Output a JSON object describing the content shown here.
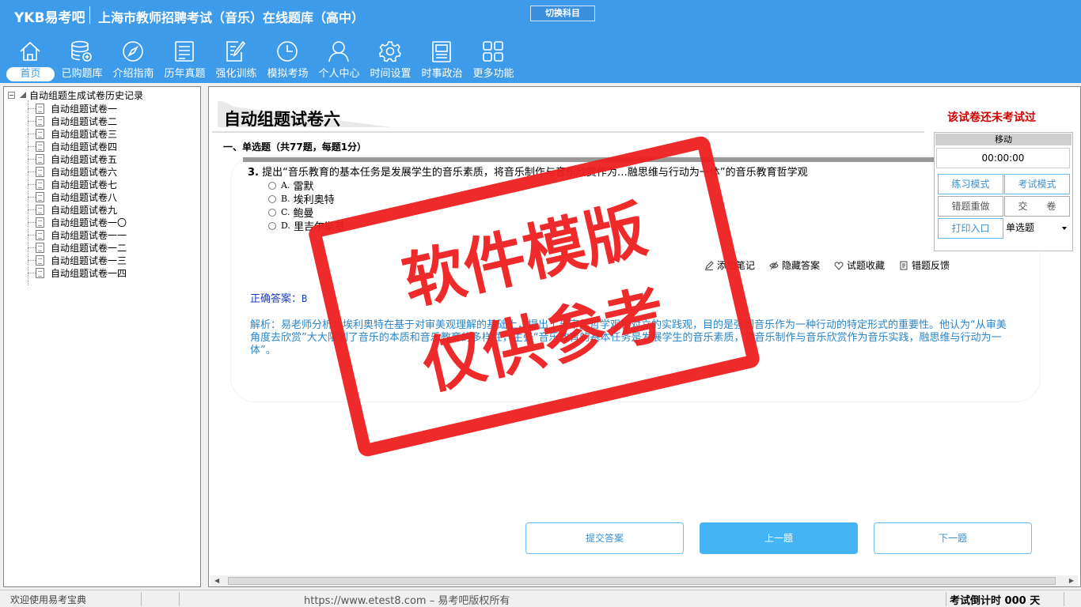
{
  "app": {
    "brand": "YKB易考吧",
    "title": "上海市教师招聘考试（音乐）在线题库（高中）",
    "switch_subject": "切换科目"
  },
  "nav": [
    {
      "label": "首页",
      "icon": "home-icon"
    },
    {
      "label": "已购题库",
      "icon": "database-icon"
    },
    {
      "label": "介绍指南",
      "icon": "compass-icon"
    },
    {
      "label": "历年真题",
      "icon": "list-icon"
    },
    {
      "label": "强化训练",
      "icon": "edit-icon"
    },
    {
      "label": "模拟考场",
      "icon": "clock-icon"
    },
    {
      "label": "个人中心",
      "icon": "user-icon"
    },
    {
      "label": "时间设置",
      "icon": "gear-icon"
    },
    {
      "label": "时事政治",
      "icon": "book-icon"
    },
    {
      "label": "更多功能",
      "icon": "grid-icon"
    }
  ],
  "tree": {
    "toggle": "−",
    "root": "自动组题生成试卷历史记录",
    "items": [
      "自动组题试卷一",
      "自动组题试卷二",
      "自动组题试卷三",
      "自动组题试卷四",
      "自动组题试卷五",
      "自动组题试卷六",
      "自动组题试卷七",
      "自动组题试卷八",
      "自动组题试卷九",
      "自动组题试卷一〇",
      "自动组题试卷一一",
      "自动组题试卷一二",
      "自动组题试卷一三",
      "自动组题试卷一四"
    ]
  },
  "paper": {
    "title": "自动组题试卷六",
    "status": "该试卷还未考试过",
    "section": "一、单选题（共77题，每题1分）"
  },
  "question": {
    "number": "3.",
    "text": "提出“音乐教育的基本任务是发展学生的音乐素质，将音乐制作与音乐欣赏作为…融思维与行动为一体”的音乐教育哲学观",
    "options": [
      {
        "key": "A.",
        "text": "雷默"
      },
      {
        "key": "B.",
        "text": "埃利奥特"
      },
      {
        "key": "C.",
        "text": "鲍曼"
      },
      {
        "key": "D.",
        "text": "里吉尔斯基"
      }
    ]
  },
  "tools": {
    "add_note": "添加笔记",
    "hide_answer": "隐藏答案",
    "favorite": "试题收藏",
    "feedback": "错题反馈"
  },
  "answer": {
    "label": "正确答案：",
    "value": "B"
  },
  "analysis": "解析：易老师分析：埃利奥特在基于对审美观理解的基础上，提出了与审美哲学观相对立的实践观，目的是强调音乐作为一种行动的特定形式的重要性。他认为“从审美角度去欣赏”大大限制了音乐的本质和音乐教育的多样性，主张“音乐教育的基本任务是发展学生的音乐素质，将音乐制作与音乐欣赏作为音乐实践，融思维与行动为一体”。",
  "buttons": {
    "submit": "提交答案",
    "prev": "上一题",
    "next": "下一题"
  },
  "side": {
    "move": "移动",
    "timer": "00:00:00",
    "practice_mode": "练习模式",
    "exam_mode": "考试模式",
    "redo_wrong": "错题重做",
    "hand_in": "交　　卷",
    "print": "打印入口",
    "type_select": "单选题"
  },
  "status": {
    "welcome": "欢迎使用易考宝典",
    "site": "https://www.etest8.com – 易考吧版权所有",
    "countdown": "考试倒计时 000 天"
  },
  "stamp": {
    "line1": "软件模版",
    "line2": "仅供参考"
  },
  "colors": {
    "topbar": "#3d9be9",
    "stamp": "#ee1f1f",
    "answer": "#1d3fbf",
    "analysis": "#2a86c8",
    "status_red": "#cc0000"
  }
}
